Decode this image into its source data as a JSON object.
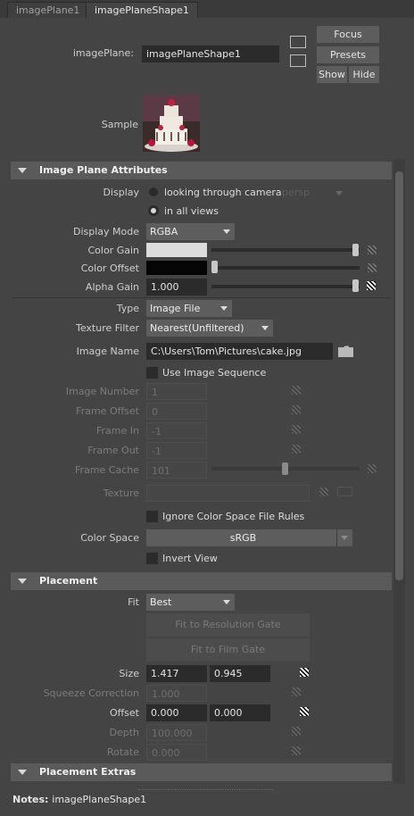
{
  "tabs": [
    "imagePlane1",
    "imagePlaneShape1"
  ],
  "header": {
    "imageplane_label": "imagePlane:",
    "imageplane_value": "imagePlaneShape1",
    "focus": "Focus",
    "presets": "Presets",
    "show": "Show",
    "hide": "Hide",
    "sample_label": "Sample"
  },
  "sections": {
    "attributes": "Image Plane Attributes",
    "placement": "Placement",
    "extras": "Placement Extras"
  },
  "attrs": {
    "display_label": "Display",
    "looking_through": "looking through camera",
    "camera_value": "persp",
    "in_all_views": "in all views",
    "display_mode_label": "Display Mode",
    "display_mode_value": "RGBA",
    "color_gain_label": "Color Gain",
    "color_offset_label": "Color Offset",
    "alpha_gain_label": "Alpha Gain",
    "alpha_gain_value": "1.000",
    "type_label": "Type",
    "type_value": "Image File",
    "texture_filter_label": "Texture Filter",
    "texture_filter_value": "Nearest(Unfiltered)",
    "image_name_label": "Image Name",
    "image_name_value": "C:\\Users\\Tom\\Pictures\\cake.jpg",
    "use_sequence": "Use Image Sequence",
    "image_number_label": "Image Number",
    "image_number_value": "1",
    "frame_offset_label": "Frame Offset",
    "frame_offset_value": "0",
    "frame_in_label": "Frame In",
    "frame_in_value": "-1",
    "frame_out_label": "Frame Out",
    "frame_out_value": "-1",
    "frame_cache_label": "Frame Cache",
    "frame_cache_value": "101",
    "texture_label": "Texture",
    "ignore_cs": "Ignore Color Space File Rules",
    "color_space_label": "Color Space",
    "color_space_value": "sRGB",
    "invert_view": "Invert View"
  },
  "placement": {
    "fit_label": "Fit",
    "fit_value": "Best",
    "fit_resolution": "Fit to Resolution Gate",
    "fit_film": "Fit to Film Gate",
    "size_label": "Size",
    "size_x": "1.417",
    "size_y": "0.945",
    "squeeze_label": "Squeeze Correction",
    "squeeze_value": "1.000",
    "offset_label": "Offset",
    "offset_x": "0.000",
    "offset_y": "0.000",
    "depth_label": "Depth",
    "depth_value": "100.000",
    "rotate_label": "Rotate",
    "rotate_value": "0.000"
  },
  "slider_levels": {
    "color_gain": 1.0,
    "color_offset": 0.0,
    "alpha_gain": 1.0,
    "frame_cache": 0.5
  },
  "notes": {
    "label": "Notes:",
    "value": "imagePlaneShape1"
  }
}
